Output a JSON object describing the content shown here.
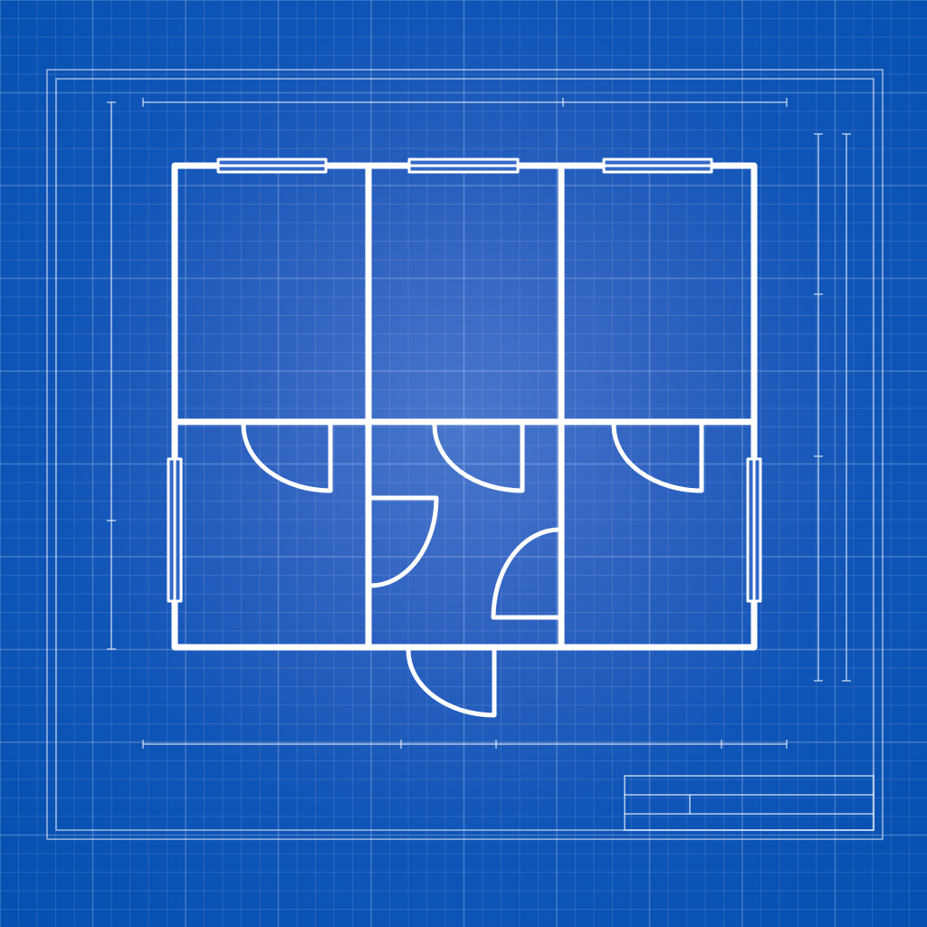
{
  "drawing": {
    "background_color": "#0550b0",
    "center_glow_color": "#4a77cc",
    "line_color": "#ffffff",
    "grid": true,
    "has_title_block": true,
    "title_block_text": []
  },
  "floor_plan": {
    "rooms": [
      "room-top-left",
      "room-top-middle",
      "room-top-right",
      "room-bottom-left",
      "room-bottom-middle",
      "room-bottom-right"
    ],
    "doors": [
      "door-bottom-left-room",
      "door-bottom-middle-room",
      "door-bottom-right-room",
      "door-hall-left",
      "door-hall-right",
      "door-entrance"
    ],
    "windows": [
      "window-top-left",
      "window-top-middle",
      "window-top-right",
      "window-left-wall",
      "window-right-wall"
    ]
  }
}
